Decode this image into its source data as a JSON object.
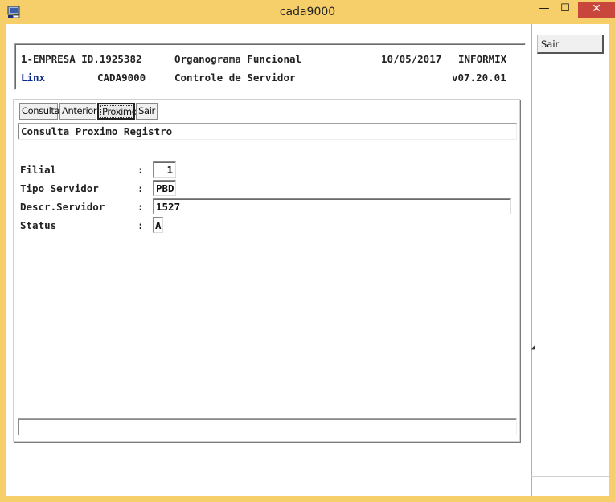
{
  "window": {
    "title": "cada9000",
    "minimize": "—",
    "maximize": "☐",
    "close": "✕"
  },
  "header": {
    "company": "1-EMPRESA ID.1925382",
    "module": "Organograma Funcional",
    "date": "10/05/2017",
    "db": "INFORMIX",
    "brand": "Linx",
    "program": "CADA9000",
    "screen": "Controle de Servidor",
    "version": "v07.20.01"
  },
  "toolbar": {
    "consulta": "Consulta",
    "anterior": "Anterior",
    "proximo": "Proximo",
    "sair": "Sair"
  },
  "message": "Consulta Proximo Registro",
  "form": {
    "filial": {
      "label": "Filial",
      "value": "1"
    },
    "tipo": {
      "label": "Tipo Servidor",
      "value": "PBD"
    },
    "descr": {
      "label": "Descr.Servidor",
      "value": "1527"
    },
    "status": {
      "label": "Status",
      "value": "A"
    },
    "colon": ":"
  },
  "side": {
    "sair": "Sair"
  }
}
